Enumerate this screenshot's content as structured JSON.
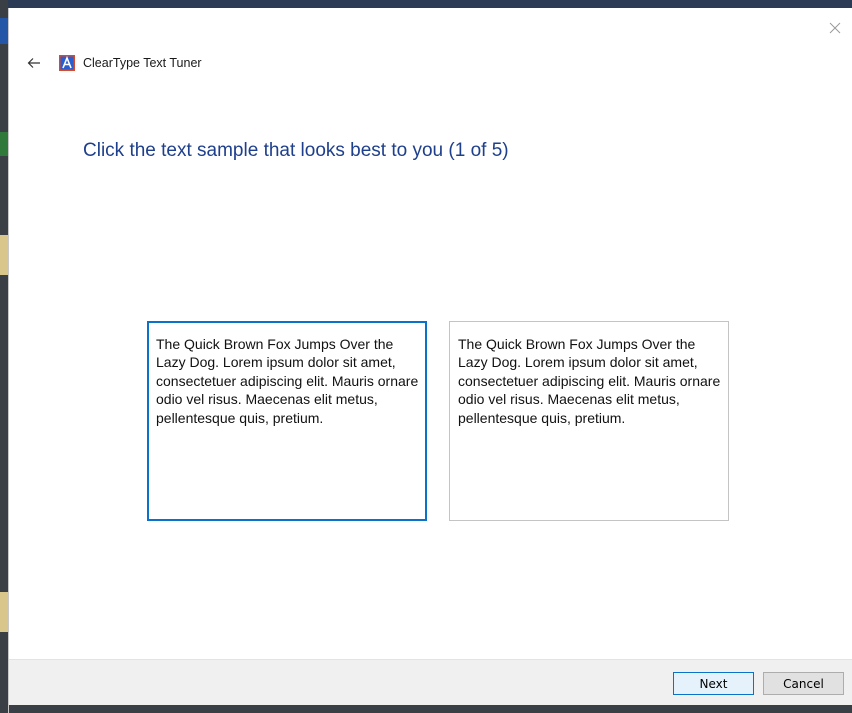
{
  "window": {
    "title": "ClearType Text Tuner"
  },
  "main": {
    "heading": "Click the text sample that looks best to you (1 of 5)",
    "samples": [
      {
        "text": "The Quick Brown Fox Jumps Over the Lazy Dog. Lorem ipsum dolor sit amet, consectetuer adipiscing elit. Mauris ornare odio vel risus. Maecenas elit metus, pellentesque quis, pretium.",
        "selected": true
      },
      {
        "text": "The Quick Brown Fox Jumps Over the Lazy Dog. Lorem ipsum dolor sit amet, consectetuer adipiscing elit. Mauris ornare odio vel risus. Maecenas elit metus, pellentesque quis, pretium.",
        "selected": false
      }
    ]
  },
  "footer": {
    "next_label": "Next",
    "cancel_label": "Cancel"
  },
  "icons": {
    "back": "arrow-left-icon",
    "close": "close-icon",
    "app": "cleartype-app-icon"
  },
  "colors": {
    "heading": "#1e3f8c",
    "selection": "#0a72c9"
  }
}
